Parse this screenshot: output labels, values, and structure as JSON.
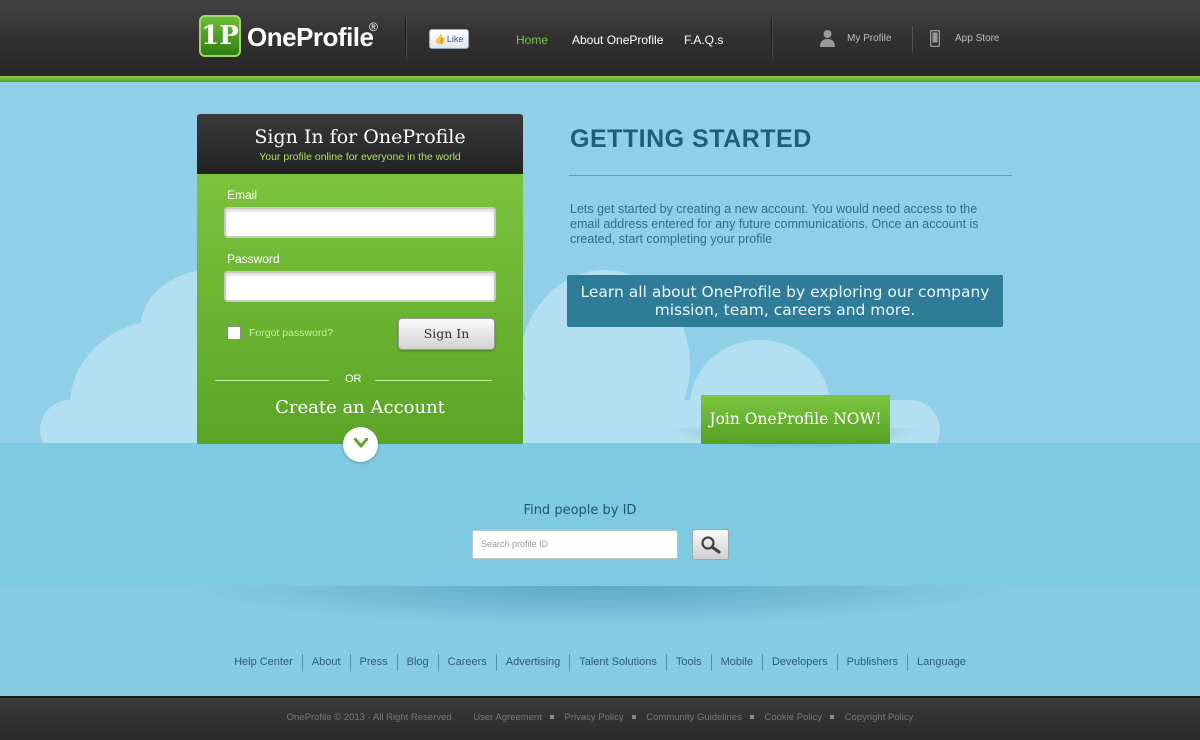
{
  "header": {
    "logo_badge": "1P",
    "logo_text": "OneProfile",
    "logo_registered": "®",
    "like_label": "Like",
    "nav": [
      {
        "label": "Home",
        "active": true
      },
      {
        "label": "About OneProfile",
        "active": false
      },
      {
        "label": "F.A.Q.s",
        "active": false
      }
    ],
    "user_nav": [
      {
        "label": "My Profile",
        "icon": "user-icon"
      },
      {
        "label": "App Store",
        "icon": "phone-icon"
      }
    ]
  },
  "signin": {
    "title": "Sign In for OneProfile",
    "subtitle": "Your profile online for everyone in the world",
    "email_label": "Email",
    "email_value": "",
    "password_label": "Password",
    "password_value": "",
    "forgot_label": "Forgot password?",
    "signin_button": "Sign In",
    "or_text": "OR",
    "create_account": "Create an Account"
  },
  "getting_started": {
    "title": "GETTING STARTED",
    "text": "Lets get started by creating a new account. You would need access to the email address entered for any future communications. Once an account is created, start completing your profile",
    "learn_text": "Learn all about OneProfile by exploring our company mission, team, careers and more.",
    "join_button": "Join OneProfile NOW!"
  },
  "search": {
    "label": "Find people by ID",
    "placeholder": "Search profile ID"
  },
  "footer": {
    "links": [
      "Help Center",
      "About",
      "Press",
      "Blog",
      "Careers",
      "Advertising",
      "Talent Solutions",
      "Tools",
      "Mobile",
      "Developers",
      "Publishers",
      "Language"
    ],
    "copyright": "OneProfile © 2013 - All Right Reserved",
    "legal": [
      "User Agreement",
      "Privacy Policy",
      "Community Guidelines",
      "Cookie Policy",
      "Copyright Policy"
    ]
  },
  "colors": {
    "accent_green": "#6cb833",
    "sky_blue": "#8fd0e8",
    "title_blue": "#1e5f77"
  }
}
